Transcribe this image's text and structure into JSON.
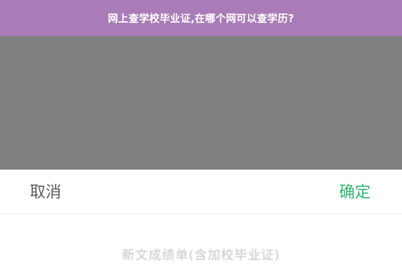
{
  "banner": {
    "title": "网上查学校毕业证,在哪个网可以查学历?",
    "color": "#a97bb7"
  },
  "overlay": {
    "color": "#7f7f7f"
  },
  "sheet": {
    "cancel_label": "取消",
    "confirm_label": "确定",
    "confirm_color": "#2fb56f",
    "picker": {
      "options": [
        "新文成绩单(含加校毕业证)",
        ""
      ]
    }
  }
}
